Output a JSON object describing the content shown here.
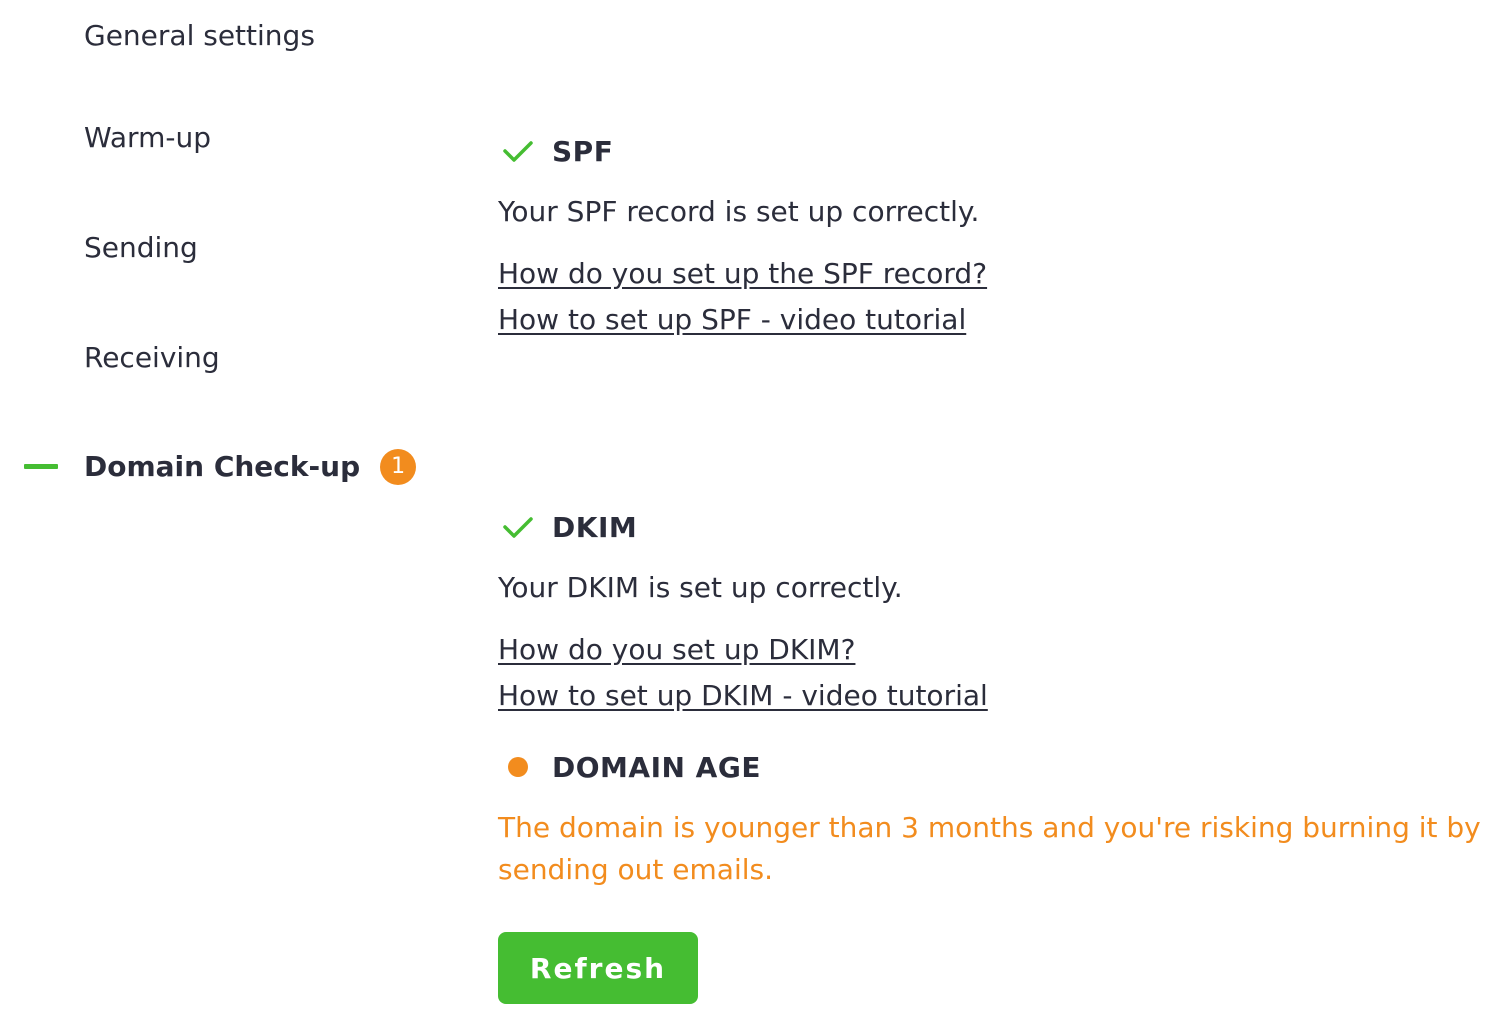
{
  "sidebar": {
    "items": [
      {
        "label": "General settings"
      },
      {
        "label": "Warm-up"
      },
      {
        "label": "Sending"
      },
      {
        "label": "Receiving"
      },
      {
        "label": "Domain Check-up",
        "badge": "1",
        "active": true
      }
    ]
  },
  "checks": {
    "spf": {
      "title": "SPF",
      "status": "ok",
      "description": "Your SPF record is set up correctly.",
      "links": [
        "How do you set up the SPF record?",
        "How to set up SPF - video tutorial"
      ]
    },
    "dkim": {
      "title": "DKIM",
      "status": "ok",
      "description": "Your DKIM is set up correctly.",
      "links": [
        "How do you set up DKIM?",
        "How to set up DKIM - video tutorial"
      ]
    },
    "domain_age": {
      "title": "DOMAIN AGE",
      "status": "warning",
      "description": "The domain is younger than 3 months and you're risking burning it by sending out emails."
    }
  },
  "actions": {
    "refresh_label": "Refresh"
  },
  "colors": {
    "accent_green": "#45bd32",
    "warning_orange": "#f28c1e",
    "text": "#2b2d3b"
  },
  "icons": {
    "ok": "check-icon",
    "warning": "warning-dot-icon"
  }
}
